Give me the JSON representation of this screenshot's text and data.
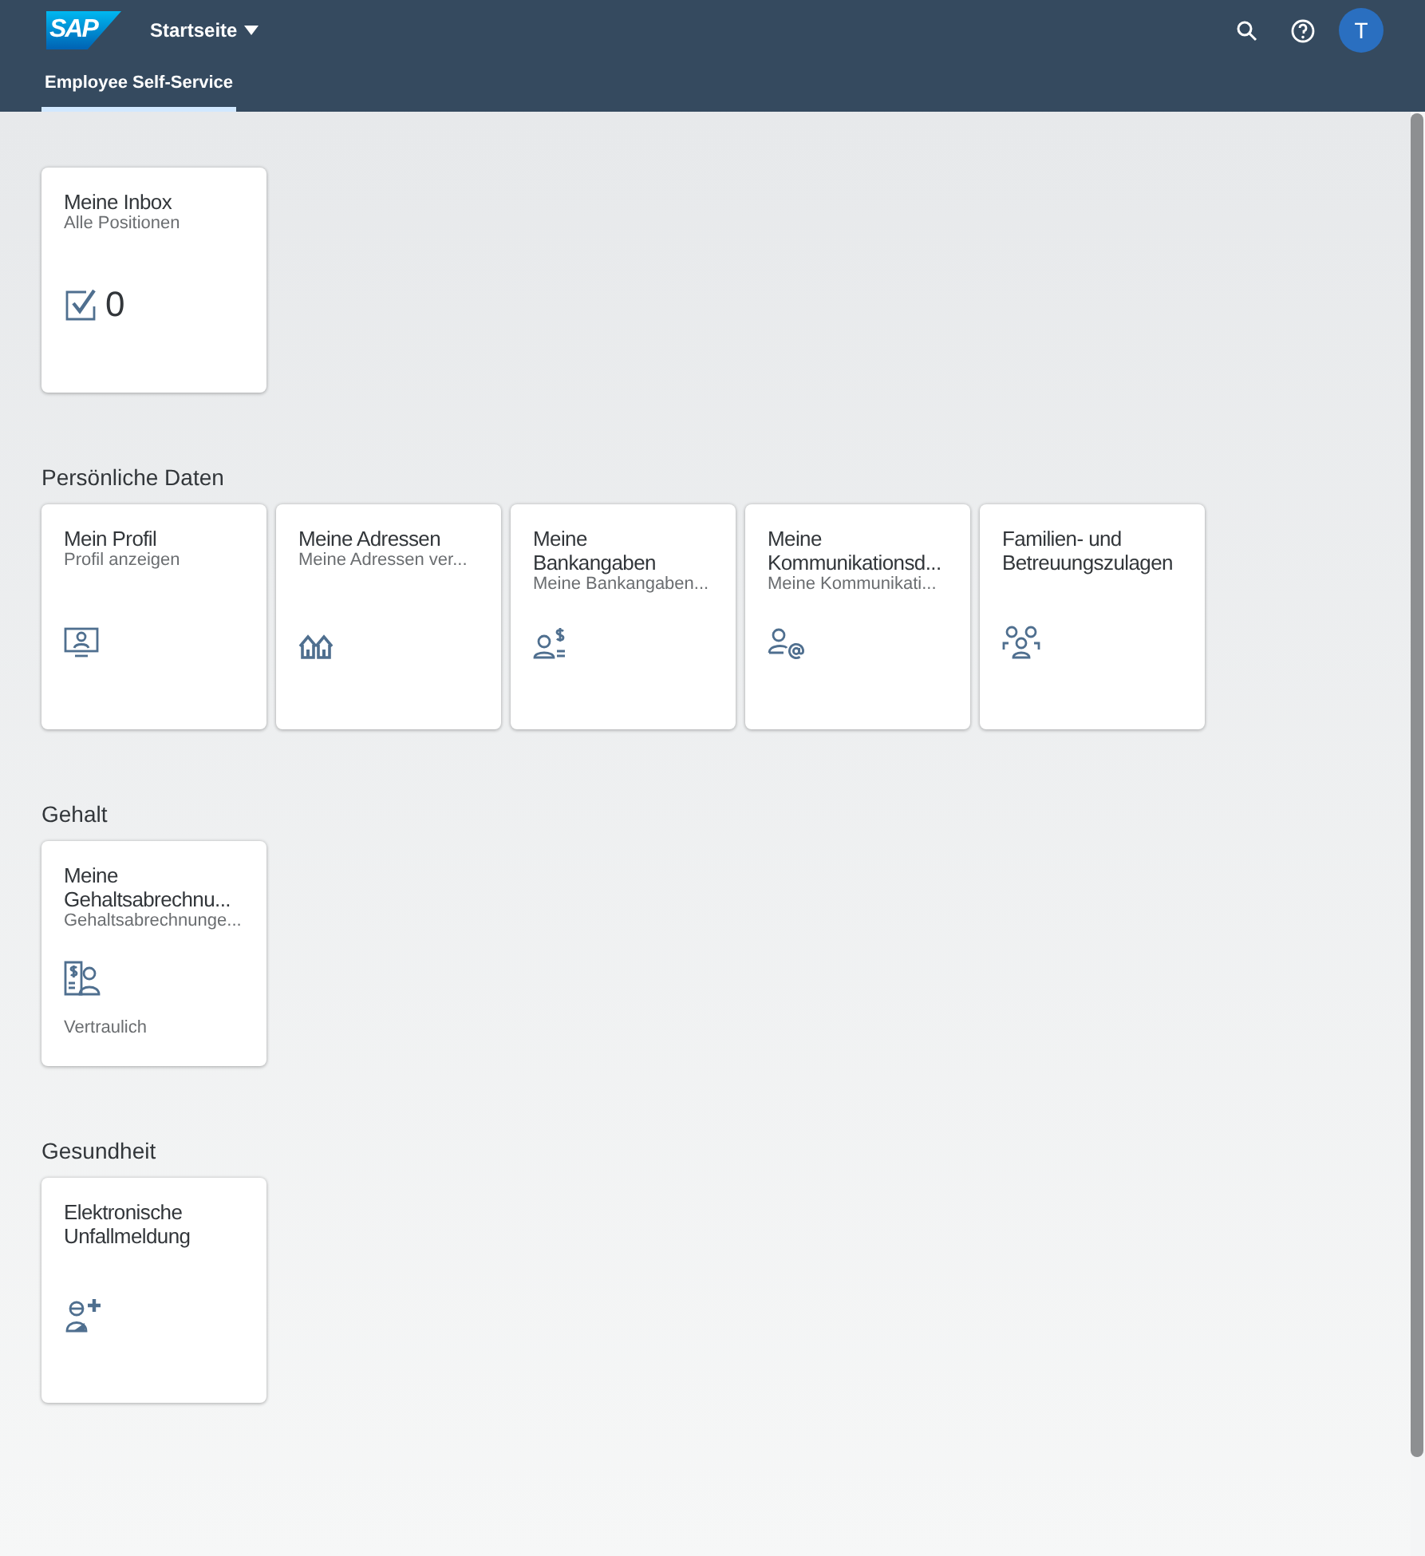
{
  "shell": {
    "logo": "SAP",
    "title": "Startseite",
    "avatar": "T"
  },
  "tabs": [
    {
      "label": "Employee Self-Service",
      "selected": true
    }
  ],
  "groups": [
    {
      "tiles": [
        {
          "title": "Meine Inbox",
          "subtitle": "Alle Positionen",
          "number": "0"
        }
      ]
    },
    {
      "title": "Persönliche Daten",
      "tiles": [
        {
          "title": "Mein Profil",
          "subtitle": "Profil anzeigen"
        },
        {
          "title": "Meine Adressen",
          "subtitle": "Meine Adressen ver..."
        },
        {
          "title": "Meine Bankangaben",
          "subtitle": "Meine Bankangaben..."
        },
        {
          "title": "Meine Kommunikationsd...",
          "subtitle": "Meine Kommunikati..."
        },
        {
          "title": "Familien- und Betreuungszulagen"
        }
      ]
    },
    {
      "title": "Gehalt",
      "tiles": [
        {
          "title": "Meine Gehaltsabrechnu...",
          "subtitle": "Gehaltsabrechnunge...",
          "footer": "Vertraulich"
        }
      ]
    },
    {
      "title": "Gesundheit",
      "tiles": [
        {
          "title": "Elektronische Unfallmeldung"
        }
      ]
    }
  ]
}
